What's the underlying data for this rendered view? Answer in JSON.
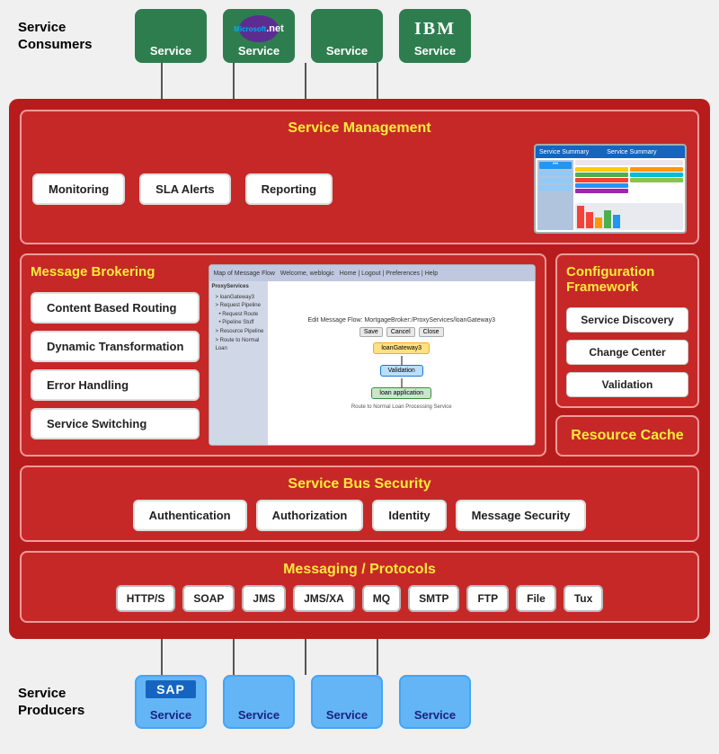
{
  "consumers": {
    "label": "Service\nConsumers",
    "services": [
      {
        "label": "Service",
        "type": "plain"
      },
      {
        "label": "Service",
        "type": "dotnet"
      },
      {
        "label": "Service",
        "type": "plain"
      },
      {
        "label": "Service",
        "type": "ibm"
      }
    ]
  },
  "producers": {
    "label": "Service\nProducers",
    "services": [
      {
        "label": "Service",
        "type": "sap"
      },
      {
        "label": "Service",
        "type": "blue"
      },
      {
        "label": "Service",
        "type": "blue"
      },
      {
        "label": "Service",
        "type": "blue"
      }
    ]
  },
  "main": {
    "service_management": {
      "title": "Service Management",
      "buttons": [
        "Monitoring",
        "SLA Alerts",
        "Reporting"
      ]
    },
    "message_brokering": {
      "title": "Message Brokering",
      "buttons": [
        "Content Based Routing",
        "Dynamic Transformation",
        "Error Handling",
        "Service Switching"
      ]
    },
    "configuration_framework": {
      "title": "Configuration Framework",
      "buttons": [
        "Service Discovery",
        "Change Center",
        "Validation"
      ]
    },
    "resource_cache": {
      "title": "Resource Cache"
    },
    "service_bus_security": {
      "title": "Service Bus Security",
      "buttons": [
        "Authentication",
        "Authorization",
        "Identity",
        "Message Security"
      ]
    },
    "messaging_protocols": {
      "title": "Messaging / Protocols",
      "buttons": [
        "HTTP/S",
        "SOAP",
        "JMS",
        "JMS/XA",
        "MQ",
        "SMTP",
        "FTP",
        "File",
        "Tux"
      ]
    }
  }
}
